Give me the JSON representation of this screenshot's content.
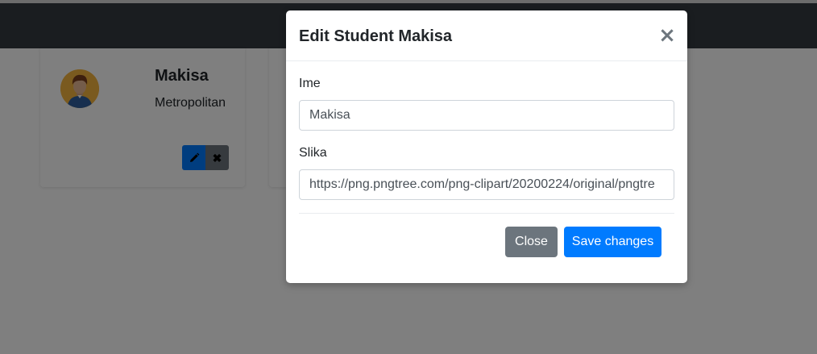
{
  "student_card": {
    "name": "Makisa",
    "school": "Metropolitan",
    "avatar_icon": "student-avatar-icon",
    "edit_icon": "pencil-icon",
    "delete_icon": "close-x-icon",
    "delete_glyph": "✖"
  },
  "modal": {
    "title": "Edit Student Makisa",
    "close_glyph": "×",
    "fields": {
      "ime": {
        "label": "Ime",
        "value": "Makisa"
      },
      "slika": {
        "label": "Slika",
        "value": "https://png.pngtree.com/png-clipart/20200224/original/pngtre"
      }
    },
    "buttons": {
      "close": "Close",
      "save": "Save changes"
    }
  },
  "colors": {
    "primary": "#007bff",
    "secondary": "#6c757d",
    "navbar": "#343a40",
    "backdrop": "rgba(0,0,0,0.5)"
  }
}
